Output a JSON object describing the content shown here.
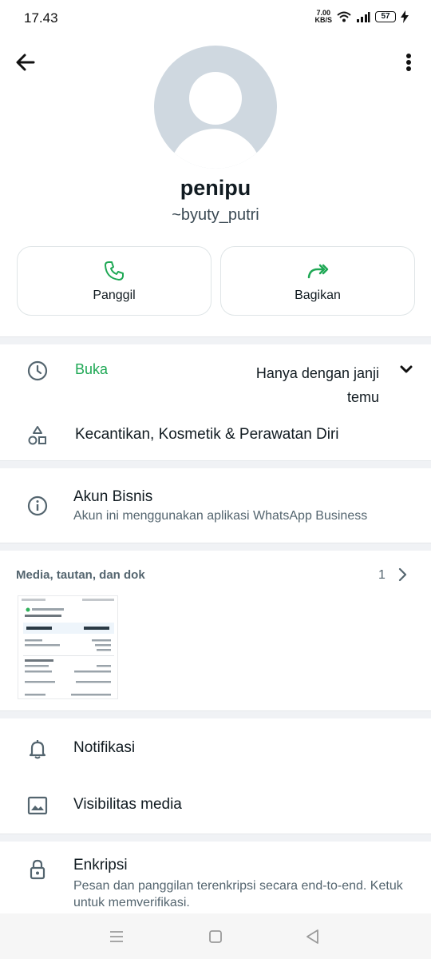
{
  "status_bar": {
    "time": "17.43",
    "net_speed_value": "7.00",
    "net_speed_unit": "KB/S",
    "battery": "57"
  },
  "profile": {
    "name": "penipu",
    "pushname": "~byuty_putri"
  },
  "actions": {
    "call_label": "Panggil",
    "share_label": "Bagikan"
  },
  "business_hours": {
    "status": "Buka",
    "value": "Hanya dengan janji temu"
  },
  "category": "Kecantikan, Kosmetik & Perawatan Diri",
  "business_account": {
    "title": "Akun Bisnis",
    "subtitle": "Akun ini menggunakan aplikasi WhatsApp Business"
  },
  "media": {
    "title": "Media, tautan, dan dok",
    "count": "1"
  },
  "menu": {
    "notifications": "Notifikasi",
    "media_visibility": "Visibilitas media"
  },
  "encryption": {
    "title": "Enkripsi",
    "subtitle": "Pesan dan panggilan terenkripsi secara end-to-end. Ketuk untuk memverifikasi."
  },
  "colors": {
    "accent_green": "#1fa855",
    "secondary_text": "#54656f",
    "avatar_bg": "#cfd8e0"
  }
}
